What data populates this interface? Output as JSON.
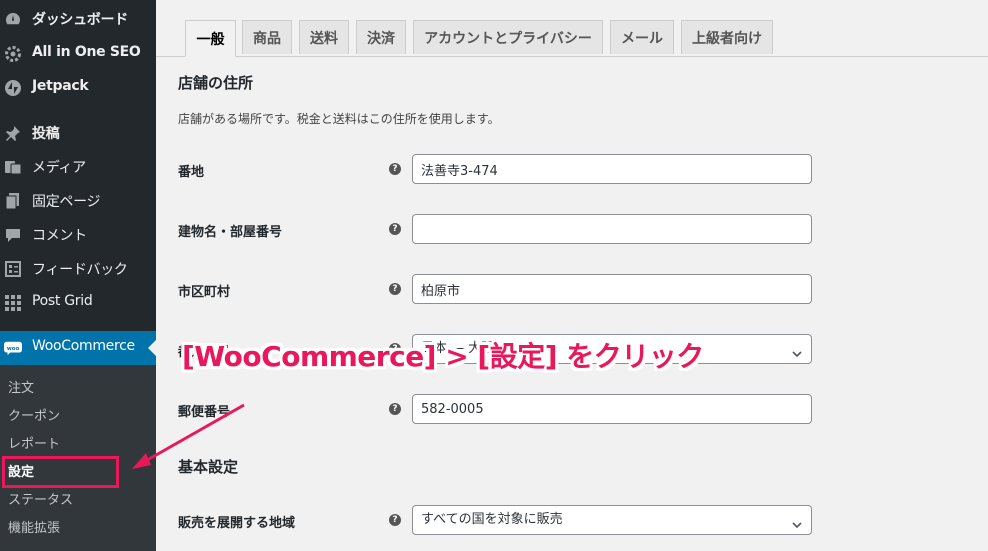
{
  "sidebar": {
    "items": [
      {
        "label": "ダッシュボード",
        "icon": "dashboard-icon"
      },
      {
        "label": "All in One SEO",
        "icon": "gear-icon"
      },
      {
        "label": "Jetpack",
        "icon": "jetpack-icon"
      },
      {
        "label": "投稿",
        "icon": "pin-icon"
      },
      {
        "label": "メディア",
        "icon": "media-icon"
      },
      {
        "label": "固定ページ",
        "icon": "page-icon"
      },
      {
        "label": "コメント",
        "icon": "comment-icon"
      },
      {
        "label": "フィードバック",
        "icon": "feedback-icon"
      },
      {
        "label": "Post Grid",
        "icon": "grid-icon"
      },
      {
        "label": "WooCommerce",
        "icon": "woo-icon"
      }
    ],
    "submenu": [
      "注文",
      "クーポン",
      "レポート",
      "設定",
      "ステータス",
      "機能拡張"
    ],
    "current_submenu": "設定",
    "accent": "#0073aa"
  },
  "tabs": [
    "一般",
    "商品",
    "送料",
    "決済",
    "アカウントとプライバシー",
    "メール",
    "上級者向け"
  ],
  "active_tab": "一般",
  "sections": {
    "address_title": "店舗の住所",
    "address_desc": "店舗がある場所です。税金と送料はこの住所を使用します。",
    "basic_title": "基本設定"
  },
  "fields": {
    "address1": {
      "label": "番地",
      "value": "法善寺3-474"
    },
    "address2": {
      "label": "建物名・部屋番号",
      "value": ""
    },
    "city": {
      "label": "市区町村",
      "value": "柏原市"
    },
    "prefecture": {
      "label": "都道府県",
      "value": "日本 — 大阪府"
    },
    "postcode": {
      "label": "郵便番号",
      "value": "582-0005"
    },
    "selling_location": {
      "label": "販売を展開する地域",
      "value": "すべての国を対象に販売"
    }
  },
  "annotation": {
    "text": "[WooCommerce] > [設定] をクリック",
    "color": "#e8185a"
  }
}
